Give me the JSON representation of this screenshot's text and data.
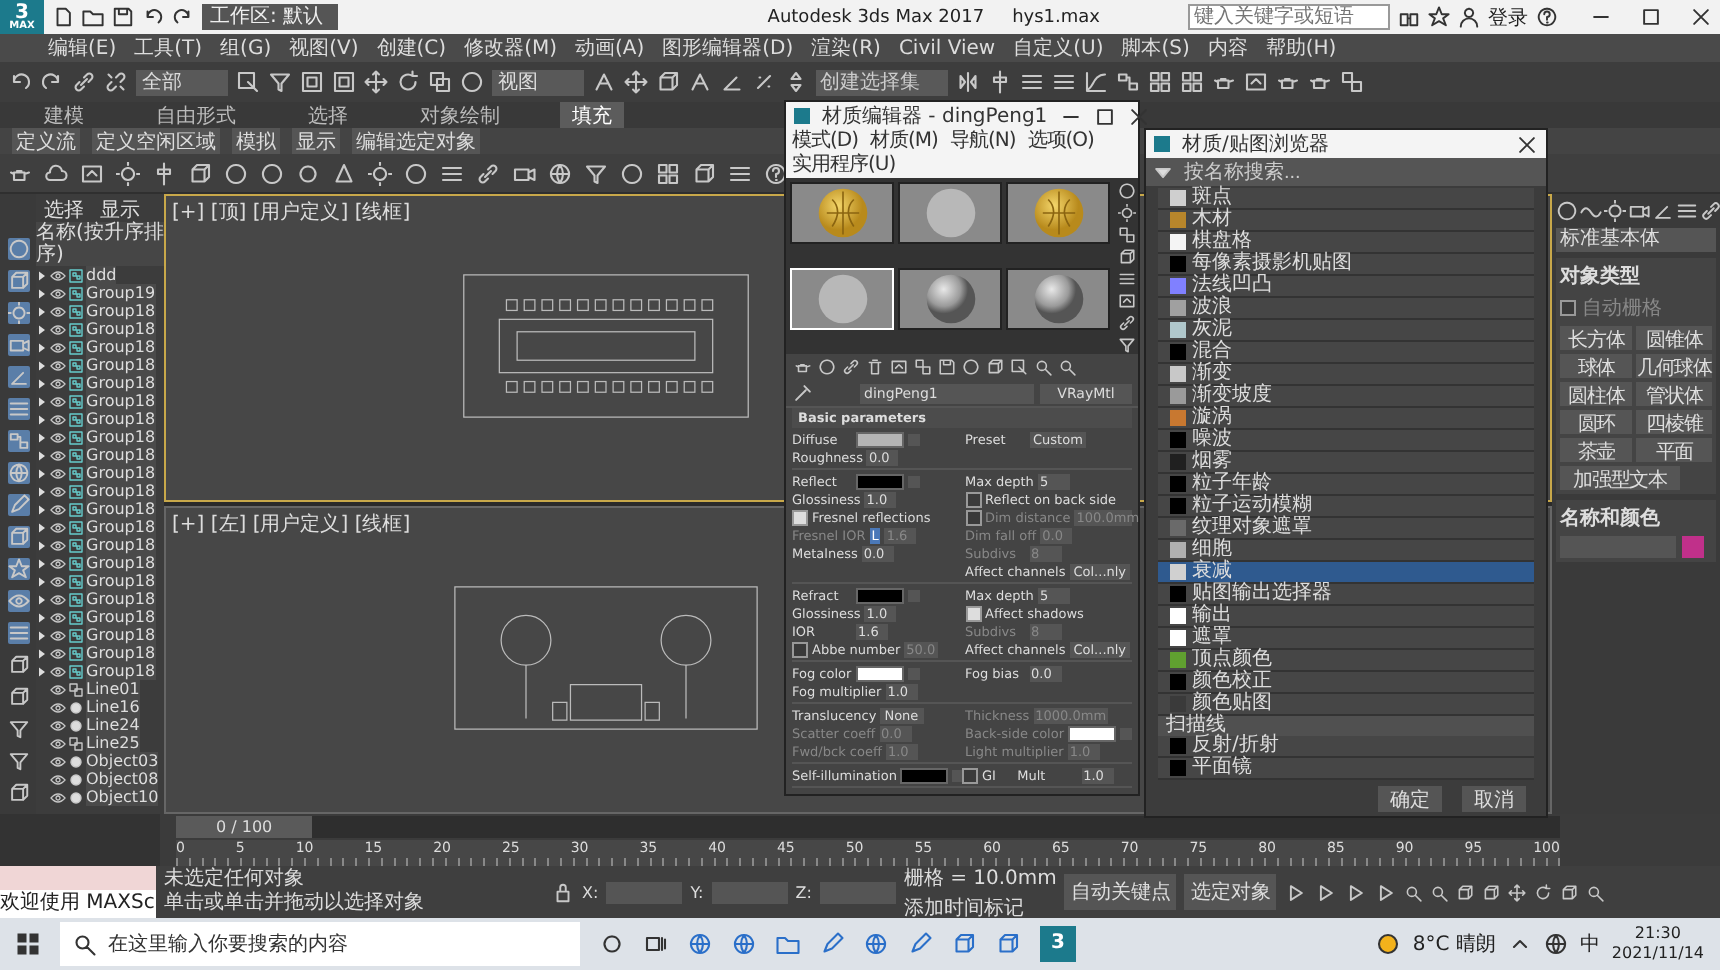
{
  "title_bar": {
    "logo": {
      "digit": "3",
      "label": "MAX"
    },
    "workspace": "工作区: 默认",
    "title": "Autodesk 3ds Max 2017",
    "file": "hys1.max",
    "search": {
      "placeholder": "键入关键字或短语"
    },
    "sign_in": "登录"
  },
  "menu": [
    "编辑(E)",
    "工具(T)",
    "组(G)",
    "视图(V)",
    "创建(C)",
    "修改器(M)",
    "动画(A)",
    "图形编辑器(D)",
    "渲染(R)",
    "Civil View",
    "自定义(U)",
    "脚本(S)",
    "内容",
    "帮助(H)"
  ],
  "toolbar": {
    "selection_filter": "全部",
    "coord_system": "视图",
    "selection_set": {
      "placeholder": "创建选择集"
    }
  },
  "ribbon": {
    "tabs": [
      {
        "label": "建模",
        "selected": false
      },
      {
        "label": "自由形式",
        "selected": false
      },
      {
        "label": "选择",
        "selected": false
      },
      {
        "label": "对象绘制",
        "selected": false
      },
      {
        "label": "填充",
        "selected": true
      }
    ],
    "subtabs": [
      "定义流",
      "定义空闲区域",
      "模拟",
      "显示",
      "编辑选定对象"
    ]
  },
  "scene_explorer": {
    "tabs": [
      "选择",
      "显示"
    ],
    "header": "名称(按升序排序)",
    "items": [
      {
        "name": "ddd",
        "kind": "group"
      },
      {
        "name": "Group19",
        "kind": "group"
      },
      {
        "name": "Group18",
        "kind": "group"
      },
      {
        "name": "Group18",
        "kind": "group"
      },
      {
        "name": "Group18",
        "kind": "group"
      },
      {
        "name": "Group18",
        "kind": "group"
      },
      {
        "name": "Group18",
        "kind": "group"
      },
      {
        "name": "Group18",
        "kind": "group"
      },
      {
        "name": "Group18",
        "kind": "group"
      },
      {
        "name": "Group18",
        "kind": "group"
      },
      {
        "name": "Group18",
        "kind": "group"
      },
      {
        "name": "Group18",
        "kind": "group"
      },
      {
        "name": "Group18",
        "kind": "group"
      },
      {
        "name": "Group18",
        "kind": "group"
      },
      {
        "name": "Group18",
        "kind": "group"
      },
      {
        "name": "Group18",
        "kind": "group"
      },
      {
        "name": "Group18",
        "kind": "group"
      },
      {
        "name": "Group18",
        "kind": "group"
      },
      {
        "name": "Group18",
        "kind": "group"
      },
      {
        "name": "Group18",
        "kind": "group"
      },
      {
        "name": "Group18",
        "kind": "group"
      },
      {
        "name": "Group18",
        "kind": "group"
      },
      {
        "name": "Group18",
        "kind": "group"
      },
      {
        "name": "Line01",
        "kind": "shape"
      },
      {
        "name": "Line16",
        "kind": "object"
      },
      {
        "name": "Line24",
        "kind": "object"
      },
      {
        "name": "Line25",
        "kind": "shape"
      },
      {
        "name": "Object03",
        "kind": "object"
      },
      {
        "name": "Object08",
        "kind": "object"
      },
      {
        "name": "Object10",
        "kind": "object"
      }
    ]
  },
  "viewports": [
    {
      "label": "[+] [顶] [用户定义] [线框]",
      "kind": "plan"
    },
    {
      "label": "[+] [左] [用户定义] [线框]",
      "kind": "elevation"
    }
  ],
  "material_editor": {
    "title": "材质编辑器 - dingPeng1",
    "menu": [
      "模式(D)",
      "材质(M)",
      "导航(N)",
      "选项(O)",
      "实用程序(U)"
    ],
    "slots": [
      {
        "kind": "textured",
        "selected": false
      },
      {
        "kind": "flat",
        "selected": false
      },
      {
        "kind": "textured",
        "selected": false
      },
      {
        "kind": "flat",
        "selected": true
      },
      {
        "kind": "shaded",
        "selected": false
      },
      {
        "kind": "shaded",
        "selected": false
      }
    ],
    "material_name": "dingPeng1",
    "material_type": "VRayMtl",
    "rollout": "Basic parameters",
    "sections": [
      [
        [
          {
            "kind": "color",
            "label": "Diffuse",
            "color": "#b4b4b4",
            "disabled": false
          },
          {
            "kind": "dropdown",
            "label": "Preset",
            "value": "Custom",
            "disabled": false
          }
        ],
        [
          {
            "kind": "spinner",
            "label": "Roughness",
            "value": "0.0",
            "disabled": false
          },
          {
            "kind": "empty"
          }
        ]
      ],
      [
        [
          {
            "kind": "color",
            "label": "Reflect",
            "color": "#000000",
            "disabled": false
          },
          {
            "kind": "spinner",
            "label": "Max depth",
            "value": "5",
            "disabled": false
          }
        ],
        [
          {
            "kind": "spinner",
            "label": "Glossiness",
            "value": "1.0",
            "disabled": false
          },
          {
            "kind": "check",
            "label": "Reflect on back side",
            "checked": false,
            "disabled": false
          }
        ],
        [
          {
            "kind": "check",
            "label": "Fresnel reflections",
            "checked": true,
            "disabled": false
          },
          {
            "kind": "check",
            "label": "Dim distance",
            "value": "100.0mm",
            "checked": false,
            "disabled": true
          }
        ],
        [
          {
            "kind": "spinner",
            "label": "Fresnel IOR",
            "lock": "L",
            "value": "1.6",
            "disabled": true
          },
          {
            "kind": "spinner",
            "label": "Dim fall off",
            "value": "0.0",
            "disabled": true
          }
        ],
        [
          {
            "kind": "spinner",
            "label": "Metalness",
            "value": "0.0",
            "disabled": false
          },
          {
            "kind": "spinner",
            "label": "Subdivs",
            "value": "8",
            "disabled": true
          }
        ],
        [
          {
            "kind": "empty"
          },
          {
            "kind": "dropdown",
            "label": "Affect channels",
            "value": "Col...nly",
            "disabled": false
          }
        ]
      ],
      [
        [
          {
            "kind": "color",
            "label": "Refract",
            "color": "#000000",
            "disabled": false
          },
          {
            "kind": "spinner",
            "label": "Max depth",
            "value": "5",
            "disabled": false
          }
        ],
        [
          {
            "kind": "spinner",
            "label": "Glossiness",
            "value": "1.0",
            "disabled": false
          },
          {
            "kind": "check",
            "label": "Affect shadows",
            "checked": true,
            "disabled": false
          }
        ],
        [
          {
            "kind": "spinner",
            "label": "IOR",
            "value": "1.6",
            "disabled": false
          },
          {
            "kind": "spinner",
            "label": "Subdivs",
            "value": "8",
            "disabled": true
          }
        ],
        [
          {
            "kind": "check",
            "label": "Abbe number",
            "value": "50.0",
            "checked": false,
            "disabled": false
          },
          {
            "kind": "dropdown",
            "label": "Affect channels",
            "value": "Col...nly",
            "disabled": false
          }
        ]
      ],
      [
        [
          {
            "kind": "color",
            "label": "Fog color",
            "color": "#ffffff",
            "disabled": false
          },
          {
            "kind": "spinner",
            "label": "Fog bias",
            "value": "0.0",
            "disabled": false
          }
        ],
        [
          {
            "kind": "spinner",
            "label": "Fog multiplier",
            "value": "1.0",
            "disabled": false
          },
          {
            "kind": "empty"
          }
        ]
      ],
      [
        [
          {
            "kind": "dropdown",
            "label": "Translucency",
            "value": "None",
            "disabled": false
          },
          {
            "kind": "spinner",
            "label": "Thickness",
            "value": "1000.0mm",
            "disabled": true
          }
        ],
        [
          {
            "kind": "spinner",
            "label": "Scatter coeff",
            "value": "0.0",
            "disabled": true
          },
          {
            "kind": "color",
            "label": "Back-side color",
            "color": "#ffffff",
            "disabled": true
          }
        ],
        [
          {
            "kind": "spinner",
            "label": "Fwd/bck coeff",
            "value": "1.0",
            "disabled": true
          },
          {
            "kind": "spinner",
            "label": "Light multiplier",
            "value": "1.0",
            "disabled": true
          }
        ]
      ],
      [
        [
          {
            "kind": "color",
            "label": "Self-illumination",
            "color": "#000000",
            "disabled": false
          },
          {
            "kind": "check",
            "label": "GI",
            "checked": false,
            "disabled": false
          },
          {
            "kind": "spinner",
            "label": "Mult",
            "value": "1.0",
            "disabled": false
          }
        ]
      ]
    ]
  },
  "browser": {
    "title": "材质/贴图浏览器",
    "search": {
      "placeholder": "按名称搜索..."
    },
    "groups": [
      {
        "items": [
          {
            "label": "斑点",
            "color": "#cfcfcf",
            "selected": false
          },
          {
            "label": "木材",
            "color": "#b8862b",
            "selected": false
          },
          {
            "label": "棋盘格",
            "color": "#f4f4f4",
            "selected": false
          },
          {
            "label": "每像素摄影机贴图",
            "color": "#000000",
            "selected": false
          },
          {
            "label": "法线凹凸",
            "color": "#8080ff",
            "selected": false
          },
          {
            "label": "波浪",
            "color": "#a0a0a0",
            "selected": false
          },
          {
            "label": "灰泥",
            "color": "#b0c8cc",
            "selected": false
          },
          {
            "label": "混合",
            "color": "#000000",
            "selected": false
          },
          {
            "label": "渐变",
            "color": "#c8c8c8",
            "selected": false
          },
          {
            "label": "渐变坡度",
            "color": "#9a9a9a",
            "selected": false
          },
          {
            "label": "漩涡",
            "color": "#c87830",
            "selected": false
          },
          {
            "label": "噪波",
            "color": "#000000",
            "selected": false
          },
          {
            "label": "烟雾",
            "color": "#202020",
            "selected": false
          },
          {
            "label": "粒子年龄",
            "color": "#000000",
            "selected": false
          },
          {
            "label": "粒子运动模糊",
            "color": "#000000",
            "selected": false
          },
          {
            "label": "纹理对象遮罩",
            "color": "#6a6a6a",
            "selected": false
          },
          {
            "label": "细胞",
            "color": "#b0b0b0",
            "selected": false
          },
          {
            "label": "衰减",
            "color": "#d0d0d0",
            "selected": true
          },
          {
            "label": "贴图输出选择器",
            "color": "#000000",
            "selected": false
          },
          {
            "label": "输出",
            "color": "#ffffff",
            "selected": false
          },
          {
            "label": "遮罩",
            "color": "#ffffff",
            "selected": false
          },
          {
            "label": "顶点颜色",
            "color": "#60a030",
            "selected": false
          },
          {
            "label": "颜色校正",
            "color": "#000000",
            "selected": false
          },
          {
            "label": "颜色贴图",
            "color": "#3a3a3a",
            "selected": false
          }
        ]
      },
      {
        "name": "扫描线",
        "items": [
          {
            "label": "反射/折射",
            "color": "#000000",
            "selected": false
          },
          {
            "label": "平面镜",
            "color": "#000000",
            "selected": false
          }
        ]
      }
    ],
    "buttons": [
      "确定",
      "取消"
    ]
  },
  "command_panel": {
    "category": "标准基本体",
    "object_type": "对象类型",
    "auto_grid": {
      "label": "自动栅格",
      "checked": false
    },
    "buttons": [
      "长方体",
      "圆锥体",
      "球体",
      "几何球体",
      "圆柱体",
      "管状体",
      "圆环",
      "四棱锥",
      "茶壶",
      "平面",
      "加强型文本"
    ],
    "name_color": "名称和颜色",
    "color": "#c0308a"
  },
  "timeline": {
    "frame": "0 / 100",
    "level": 0,
    "ticks": [
      "0",
      "5",
      "10",
      "15",
      "20",
      "25",
      "30",
      "35",
      "40",
      "45",
      "50",
      "55",
      "60",
      "65",
      "70",
      "75",
      "80",
      "85",
      "90",
      "95",
      "100"
    ]
  },
  "status_bar": {
    "listener": "欢迎使用 MAXSc",
    "messages": [
      "未选定任何对象",
      "单击或单击并拖动以选择对象"
    ],
    "coords": [
      "X:",
      "Y:",
      "Z:"
    ],
    "grid": "栅格 = 10.0mm",
    "add_tag": "添加时间标记",
    "auto_key": "自动关键点",
    "key_filter": "选定对象"
  },
  "taskbar": {
    "max_icon": "3",
    "search": {
      "placeholder": "在这里输入你要搜索的内容"
    },
    "weather": "8°C 晴朗",
    "ime": "中",
    "time": "21:30",
    "date": "2021/11/14"
  }
}
